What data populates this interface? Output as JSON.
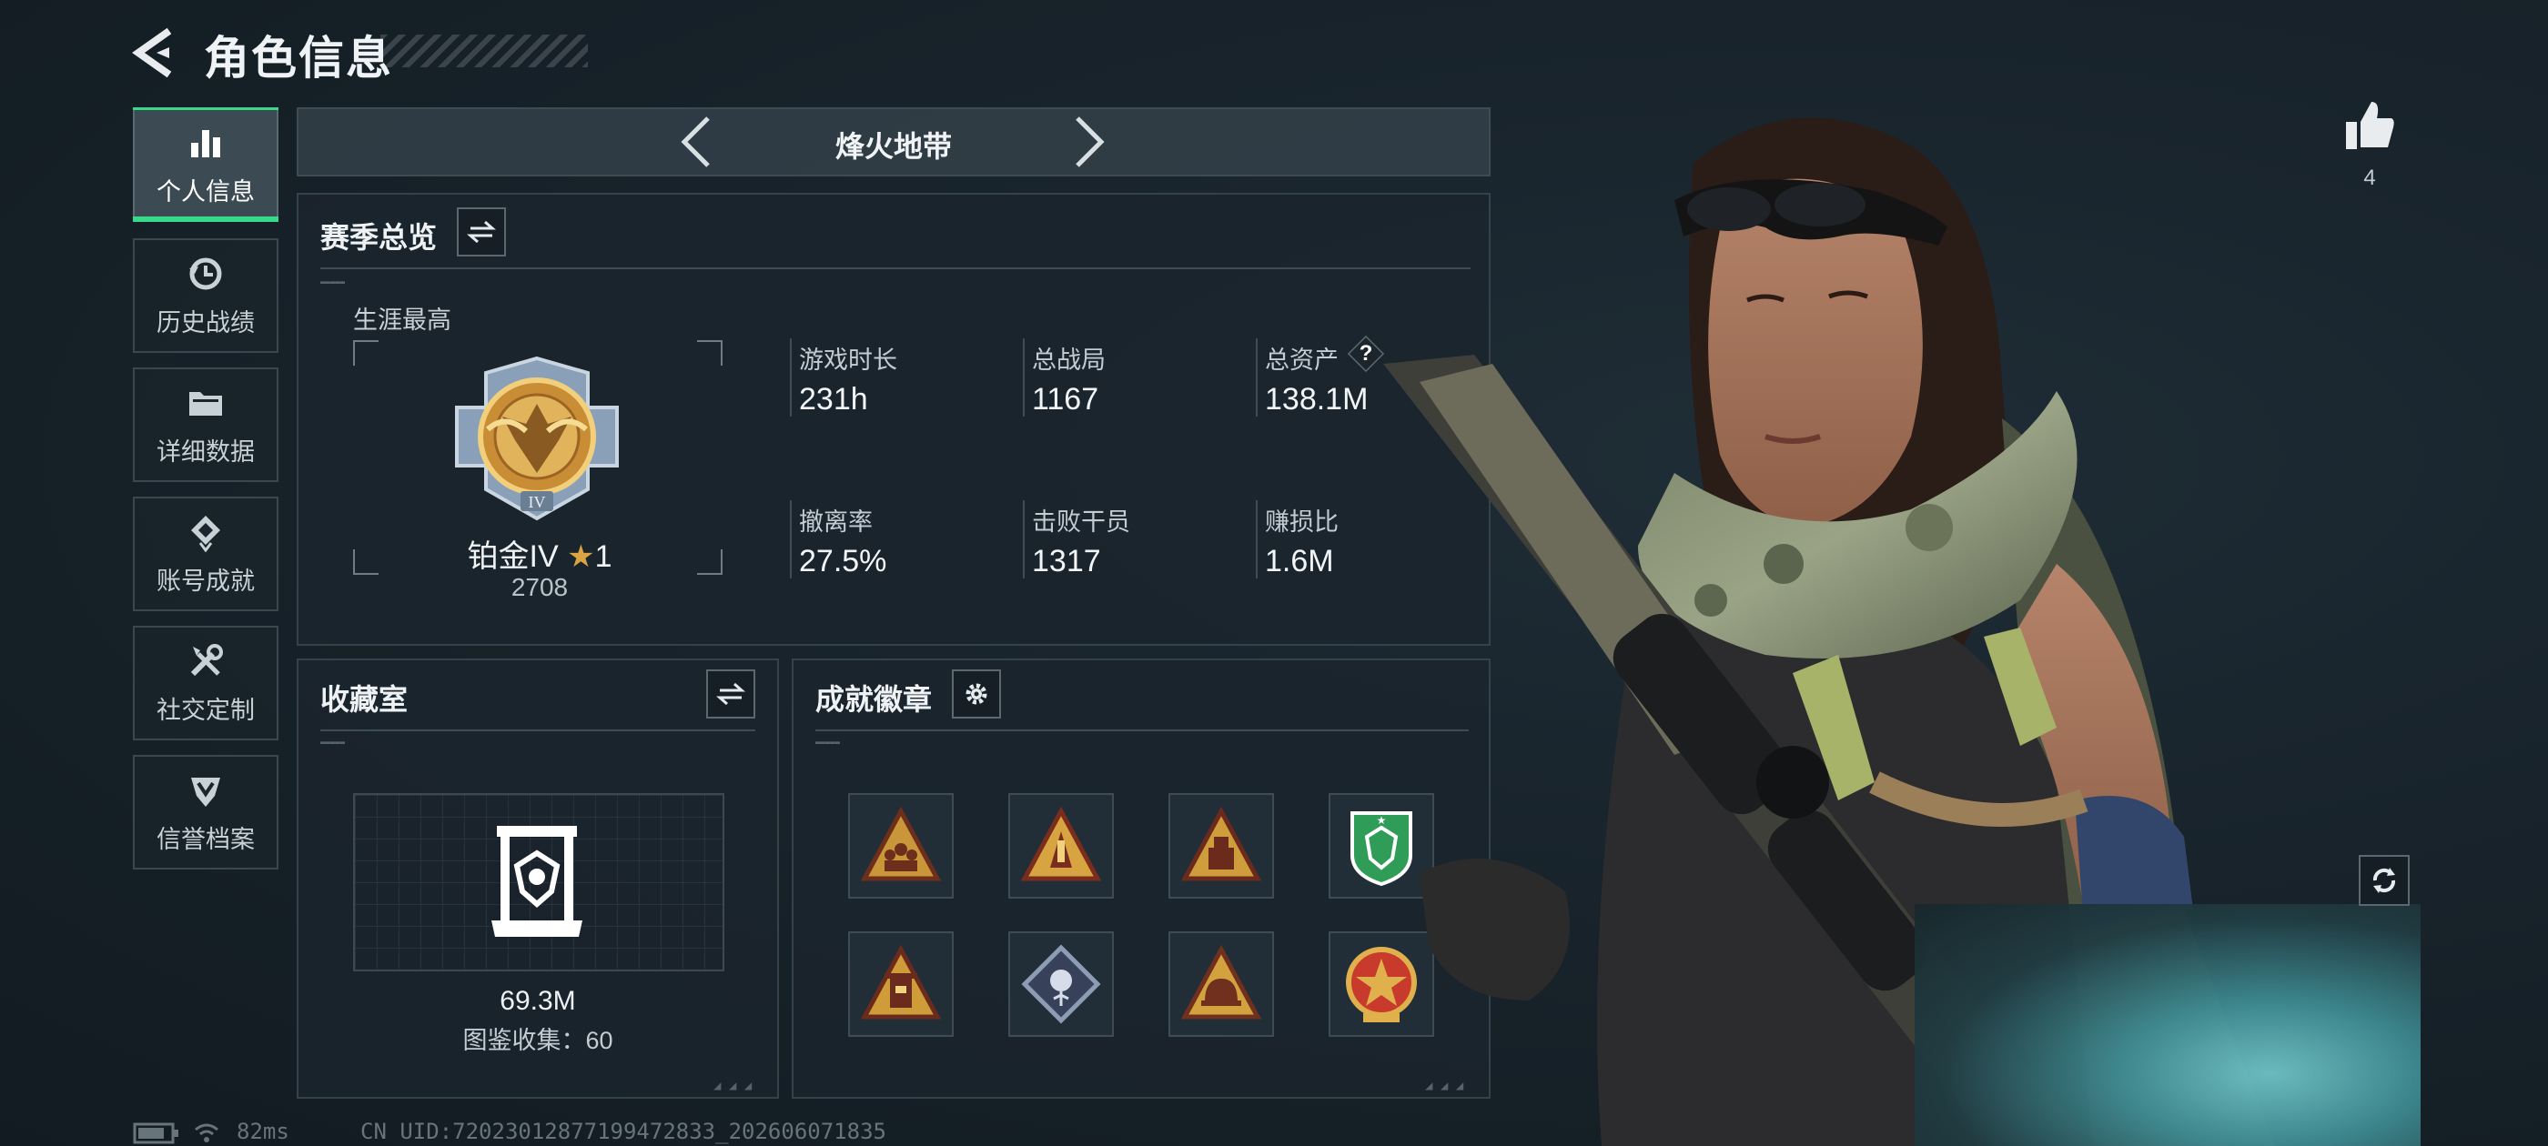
{
  "header": {
    "title": "角色信息"
  },
  "sidebar": {
    "items": [
      {
        "label": "个人信息",
        "icon": "bar-chart-icon",
        "active": true
      },
      {
        "label": "历史战绩",
        "icon": "history-icon"
      },
      {
        "label": "详细数据",
        "icon": "folder-icon"
      },
      {
        "label": "账号成就",
        "icon": "achievement-icon"
      },
      {
        "label": "社交定制",
        "icon": "tools-icon"
      },
      {
        "label": "信誉档案",
        "icon": "shield-icon"
      }
    ]
  },
  "map_selector": {
    "name": "烽火地带"
  },
  "season": {
    "title": "赛季总览",
    "career_label": "生涯最高",
    "rank_name": "铂金IV",
    "rank_stars": "1",
    "rank_score": "2708",
    "rank_emblem_numeral": "IV",
    "stats": [
      {
        "label": "游戏时长",
        "value": "231h"
      },
      {
        "label": "总战局",
        "value": "1167"
      },
      {
        "label": "总资产",
        "value": "138.1M",
        "help": "?"
      },
      {
        "label": "撤离率",
        "value": "27.5%"
      },
      {
        "label": "击败干员",
        "value": "1317"
      },
      {
        "label": "赚损比",
        "value": "1.6M"
      }
    ]
  },
  "collection": {
    "title": "收藏室",
    "value": "69.3M",
    "catalog_label": "图鉴收集：60"
  },
  "achievements": {
    "title": "成就徽章",
    "badges": [
      {
        "icon": "team-triangle-badge-icon",
        "colors": [
          "#c9973a",
          "#6e2e1c"
        ]
      },
      {
        "icon": "number-one-triangle-badge-icon",
        "colors": [
          "#d8a442",
          "#7a2d1c"
        ]
      },
      {
        "icon": "crate-triangle-badge-icon",
        "colors": [
          "#cf9d3c",
          "#6b2a1b"
        ]
      },
      {
        "icon": "green-shield-badge-icon",
        "colors": [
          "#2f9c57",
          "#0f3d22"
        ]
      },
      {
        "icon": "tower-triangle-badge-icon",
        "colors": [
          "#d09b39",
          "#6a2b1c"
        ]
      },
      {
        "icon": "diamond-rose-badge-icon",
        "colors": [
          "#8d9bb5",
          "#37425a"
        ]
      },
      {
        "icon": "helmet-triangle-badge-icon",
        "colors": [
          "#d4a13f",
          "#70301d"
        ]
      },
      {
        "icon": "star-medal-badge-icon",
        "colors": [
          "#c83b2c",
          "#e0b04c"
        ]
      }
    ]
  },
  "like": {
    "count": "4"
  },
  "status_bar": {
    "ping": "82ms",
    "uid": "CN UID:7202301287719947283​3_202606071835"
  },
  "colors": {
    "accent": "#39d98a",
    "gold": "#d9a441",
    "panel_bg": "#1b252d"
  }
}
